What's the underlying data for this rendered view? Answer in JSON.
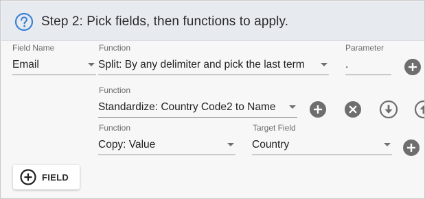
{
  "header": {
    "title": "Step 2: Pick fields, then functions to apply."
  },
  "row1": {
    "field_label": "Field Name",
    "field_value": "Email",
    "function_label": "Function",
    "function_value": "Split: By any delimiter and pick the last term",
    "parameter_label": "Parameter",
    "parameter_value": "."
  },
  "row2": {
    "function_label": "Function",
    "function_value": "Standardize: Country Code2 to Name"
  },
  "row3": {
    "function_label": "Function",
    "function_value": "Copy: Value",
    "target_label": "Target Field",
    "target_value": "Country"
  },
  "add_field_button": {
    "label": "FIELD"
  },
  "colors": {
    "header_bg": "#e7eaef",
    "help_icon": "#3b82d6",
    "icon_fill": "#6e6e6e"
  },
  "icons": [
    "help-icon",
    "add-circle-icon",
    "remove-circle-icon",
    "move-down-icon",
    "move-up-icon",
    "add-outline-icon"
  ]
}
